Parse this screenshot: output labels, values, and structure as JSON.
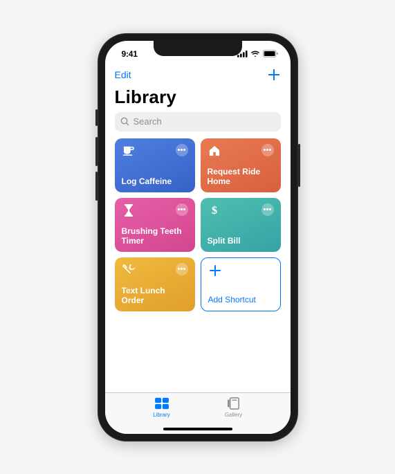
{
  "status": {
    "time": "9:41"
  },
  "nav": {
    "edit": "Edit"
  },
  "title": "Library",
  "search": {
    "placeholder": "Search"
  },
  "tiles": [
    {
      "label": "Log Caffeine"
    },
    {
      "label": "Request Ride Home"
    },
    {
      "label": "Brushing Teeth Timer"
    },
    {
      "label": "Split Bill"
    },
    {
      "label": "Text Lunch Order"
    },
    {
      "label": "Add Shortcut"
    }
  ],
  "tabs": {
    "library": "Library",
    "gallery": "Gallery"
  }
}
